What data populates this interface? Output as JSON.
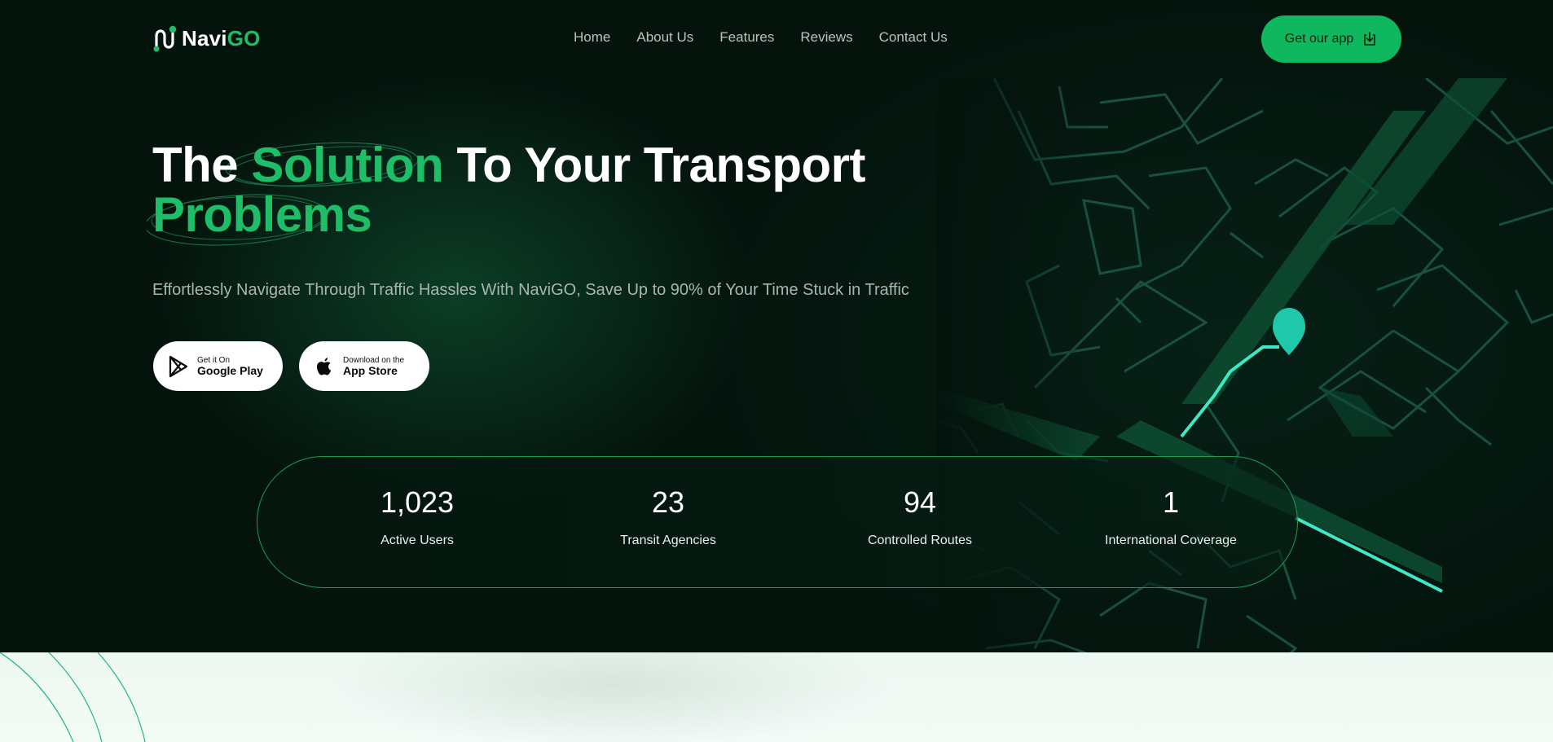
{
  "brand": {
    "name_white": "Navi",
    "name_green": "GO"
  },
  "nav": {
    "items": [
      "Home",
      "About Us",
      "Features",
      "Reviews",
      "Contact Us"
    ]
  },
  "cta": {
    "label": "Get our app"
  },
  "hero": {
    "title_part1": "The ",
    "title_highlight1": "Solution",
    "title_part2": " To Your Transport",
    "title_highlight2": "Problems",
    "subtitle": "Effortlessly Navigate Through Traffic Hassles With NaviGO, Save Up to 90% of Your Time Stuck in Traffic"
  },
  "stores": {
    "google": {
      "small": "Get it On",
      "big": "Google Play"
    },
    "apple": {
      "small": "Download on the",
      "big": "App Store"
    }
  },
  "stats": [
    {
      "value": "1,023",
      "label": "Active Users"
    },
    {
      "value": "23",
      "label": "Transit Agencies"
    },
    {
      "value": "94",
      "label": "Controlled Routes"
    },
    {
      "value": "1",
      "label": "International Coverage"
    }
  ],
  "colors": {
    "accent": "#1fbd67",
    "background": "#04140d",
    "cta": "#0fb85e",
    "route": "#3ee8c6"
  },
  "icons": {
    "cta": "download-icon",
    "google": "play-icon",
    "apple": "apple-icon",
    "logo": "route-pin-icon"
  }
}
